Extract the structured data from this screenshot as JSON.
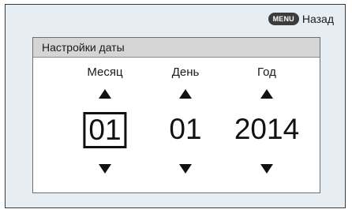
{
  "back": {
    "key_label": "MENU",
    "label": "Назад"
  },
  "panel": {
    "title": "Настройки даты"
  },
  "fields": [
    {
      "label": "Месяц",
      "value": "01",
      "selected": true
    },
    {
      "label": "День",
      "value": "01",
      "selected": false
    },
    {
      "label": "Год",
      "value": "2014",
      "selected": false
    }
  ],
  "icons": {
    "up": "triangle-up-icon",
    "down": "triangle-down-icon"
  },
  "colors": {
    "screen_background": "#e6eef3",
    "header_background": "#d5d5d5",
    "menu_key_background": "#3c3c3c"
  }
}
